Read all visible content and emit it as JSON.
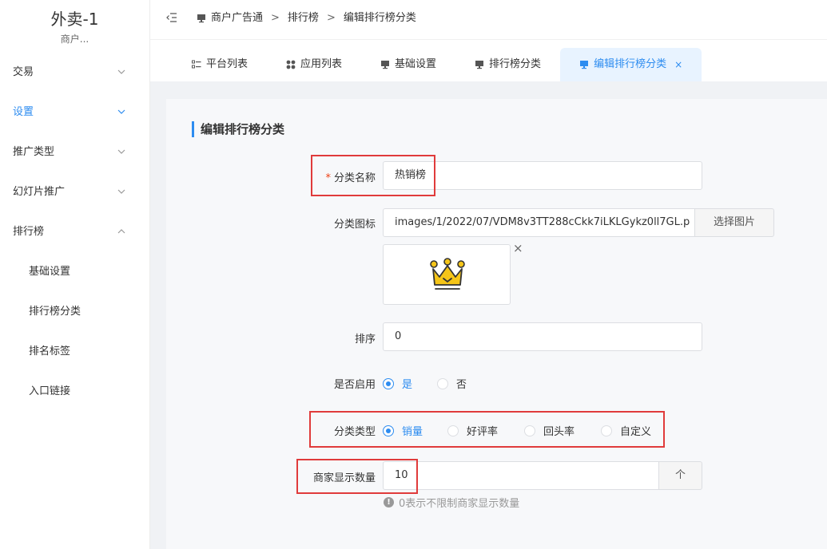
{
  "sidebar": {
    "brand_title": "外卖-1",
    "brand_sub": "商户...",
    "items": [
      {
        "label": "交易"
      },
      {
        "label": "设置"
      },
      {
        "label": "推广类型"
      },
      {
        "label": "幻灯片推广"
      },
      {
        "label": "排行榜"
      }
    ],
    "subitems": [
      {
        "label": "基础设置"
      },
      {
        "label": "排行榜分类"
      },
      {
        "label": "排名标签"
      },
      {
        "label": "入口链接"
      }
    ]
  },
  "breadcrumb": {
    "items": [
      "商户广告通",
      "排行榜",
      "编辑排行榜分类"
    ],
    "separator": ">"
  },
  "tabs": [
    {
      "label": "平台列表"
    },
    {
      "label": "应用列表"
    },
    {
      "label": "基础设置"
    },
    {
      "label": "排行榜分类"
    },
    {
      "label": "编辑排行榜分类",
      "close": "×"
    }
  ],
  "form": {
    "section_title": "编辑排行榜分类",
    "name_label": "分类名称",
    "name_required": "*",
    "name_value": "热销榜",
    "icon_label": "分类图标",
    "icon_value": "images/1/2022/07/VDM8v3TT288cCkk7iLKLGykz0ll7GL.p",
    "icon_button": "选择图片",
    "remove_icon": "×",
    "sort_label": "排序",
    "sort_value": "0",
    "enabled_label": "是否启用",
    "enabled_options": [
      "是",
      "否"
    ],
    "type_label": "分类类型",
    "type_options": [
      "销量",
      "好评率",
      "回头率",
      "自定义"
    ],
    "count_label": "商家显示数量",
    "count_value": "10",
    "count_button": "个",
    "count_hint_icon": "!",
    "count_hint": "0表示不限制商家显示数量"
  },
  "colors": {
    "accent": "#2d8cf0",
    "highlight_box": "#e03b3b",
    "crown": "#f5c518"
  }
}
